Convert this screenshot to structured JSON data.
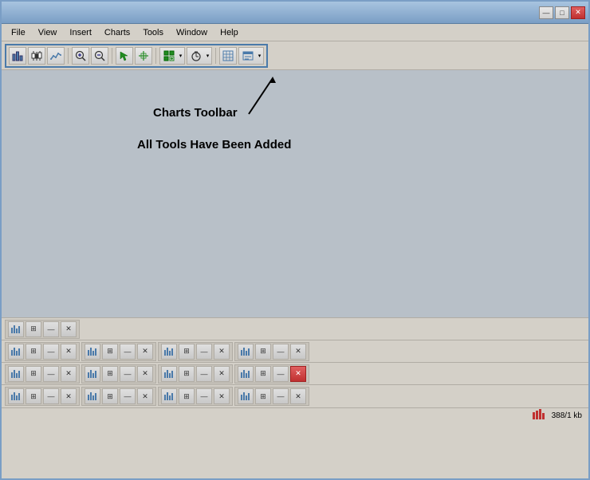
{
  "titlebar": {
    "minimize_label": "—",
    "maximize_label": "□",
    "close_label": "✕",
    "corner_num": "4"
  },
  "menubar": {
    "items": [
      {
        "label": "File"
      },
      {
        "label": "View"
      },
      {
        "label": "Insert"
      },
      {
        "label": "Charts"
      },
      {
        "label": "Tools"
      },
      {
        "label": "Window"
      },
      {
        "label": "Help"
      }
    ]
  },
  "toolbar": {
    "buttons": [
      {
        "icon": "↕",
        "name": "chart-type-1"
      },
      {
        "icon": "↕",
        "name": "chart-type-2"
      },
      {
        "icon": "~",
        "name": "chart-type-3"
      },
      {
        "icon": "⊕",
        "name": "zoom-in"
      },
      {
        "icon": "⊖",
        "name": "zoom-out"
      },
      {
        "icon": "▶",
        "name": "cursor"
      },
      {
        "icon": "⇥",
        "name": "crosshair"
      },
      {
        "icon": "✚",
        "name": "add-chart"
      },
      {
        "icon": "◴",
        "name": "timer"
      },
      {
        "icon": "▤",
        "name": "grid"
      },
      {
        "icon": "🖼",
        "name": "template"
      }
    ]
  },
  "main": {
    "annotation_charts": "Charts Toolbar",
    "annotation_tools": "All Tools Have Been Added"
  },
  "bottom": {
    "rows": [
      {
        "groups": [
          {
            "btns": [
              "📋",
              "□",
              "—",
              "✕"
            ],
            "count": 1
          }
        ]
      },
      {
        "groups": [
          {
            "btns": [
              "📋",
              "□",
              "—",
              "✕"
            ],
            "count": 4
          }
        ]
      },
      {
        "groups": [
          {
            "btns": [
              "📋",
              "□",
              "—",
              "✕"
            ],
            "count": 4
          }
        ]
      },
      {
        "groups": [
          {
            "btns": [
              "📋",
              "□",
              "—",
              "✕"
            ],
            "count": 4
          }
        ]
      }
    ]
  },
  "statusbar": {
    "status_icon": "|||",
    "memory": "388/1 kb"
  },
  "colors": {
    "accent": "#4a7aaa",
    "bg": "#d4d0c8",
    "main_bg": "#b8c0c8",
    "close_red": "#c03030"
  }
}
